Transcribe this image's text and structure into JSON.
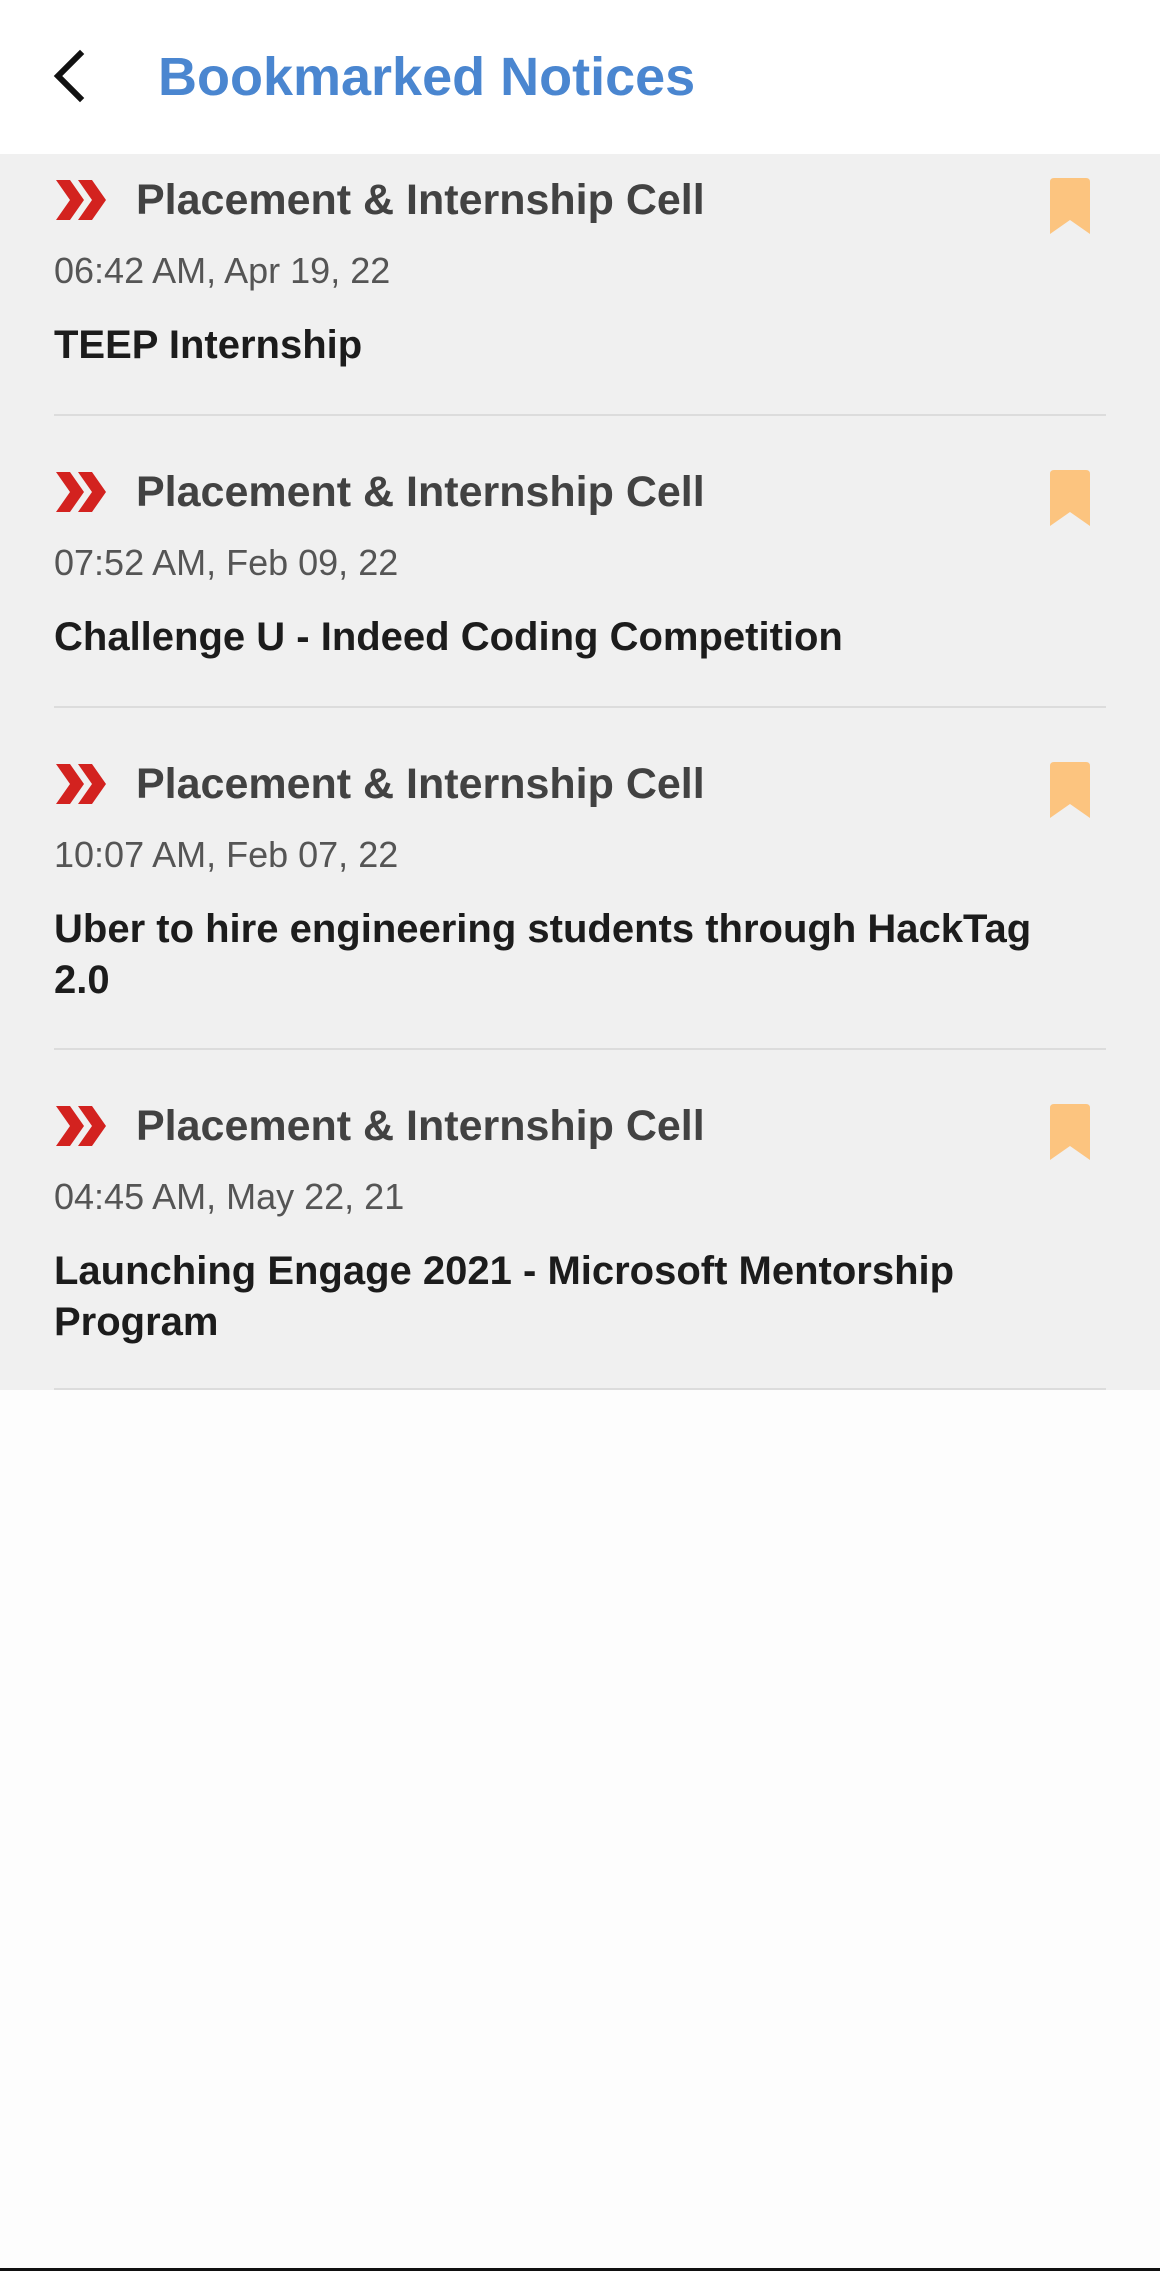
{
  "header": {
    "title": "Bookmarked Notices",
    "back_icon": "chevron-left-icon"
  },
  "colors": {
    "title": "#4a86d0",
    "chevron": "#d3221f",
    "bookmark": "#fcc47f",
    "list_bg": "#f0f0f0"
  },
  "notices": [
    {
      "source": "Placement & Internship Cell",
      "time": "06:42 AM, Apr 19, 22",
      "title": "TEEP Internship",
      "bookmarked": true
    },
    {
      "source": "Placement & Internship Cell",
      "time": "07:52 AM, Feb 09, 22",
      "title": "Challenge U - Indeed Coding Competition",
      "bookmarked": true
    },
    {
      "source": "Placement & Internship Cell",
      "time": "10:07 AM, Feb 07, 22",
      "title": "Uber to hire engineering students through HackTag 2.0",
      "bookmarked": true
    },
    {
      "source": "Placement & Internship Cell",
      "time": "04:45 AM, May 22, 21",
      "title": "Launching Engage 2021 - Microsoft Mentorship Program",
      "bookmarked": true
    }
  ]
}
